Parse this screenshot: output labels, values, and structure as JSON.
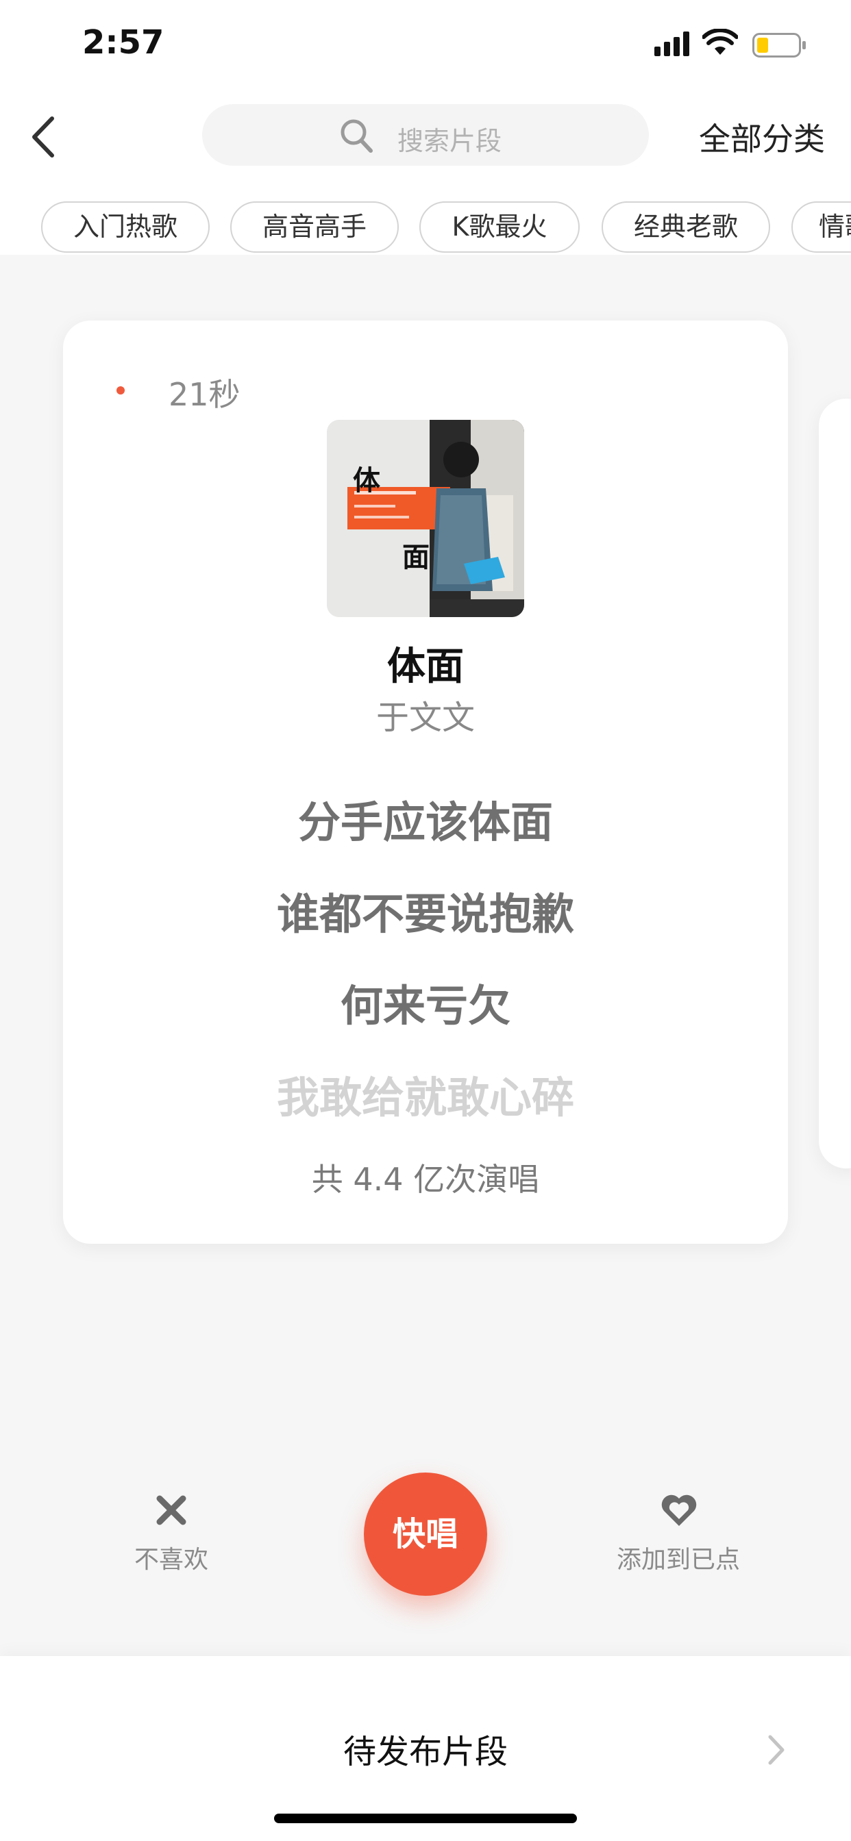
{
  "status_bar": {
    "time": "2:57"
  },
  "nav": {
    "search_placeholder": "搜索片段",
    "all_categories_label": "全部分类"
  },
  "chips": [
    {
      "label": "入门热歌"
    },
    {
      "label": "高音高手"
    },
    {
      "label": "K歌最火"
    },
    {
      "label": "经典老歌"
    },
    {
      "label": "情歌"
    }
  ],
  "card": {
    "duration": "21秒",
    "cover": {
      "title_chars": [
        "体",
        "面"
      ],
      "icon": "album-cover-image",
      "accent_color": "#f05a28"
    },
    "song_title": "体面",
    "artist": "于文文",
    "lyrics": [
      {
        "text": "分手应该体面"
      },
      {
        "text": "谁都不要说抱歉"
      },
      {
        "text": "何来亏欠"
      },
      {
        "text": "我敢给就敢心碎"
      }
    ],
    "play_count": "共 4.4 亿次演唱"
  },
  "actions": {
    "dislike_label": "不喜欢",
    "sing_label": "快唱",
    "add_label": "添加到已点",
    "sing_color": "#f0573a"
  },
  "bottom": {
    "pending_label": "待发布片段"
  }
}
